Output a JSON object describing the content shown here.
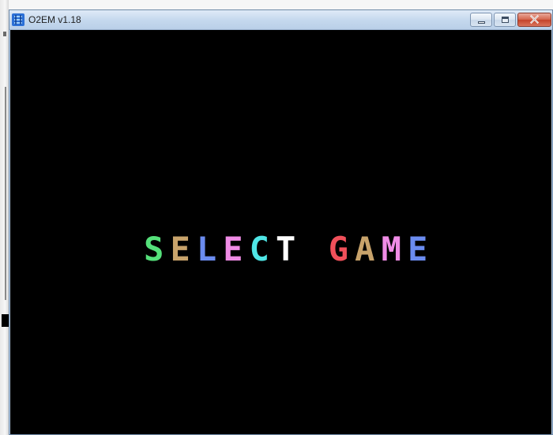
{
  "window": {
    "title": "O2EM v1.18",
    "app_icon": "o2em-app-icon",
    "controls": {
      "minimize": "minimize-icon",
      "maximize": "maximize-icon",
      "close": "close-icon"
    }
  },
  "screen": {
    "background_color": "#000000",
    "text_lines": [
      {
        "words": [
          {
            "letters": [
              {
                "char": "S",
                "color": "#55e07a"
              },
              {
                "char": "E",
                "color": "#c8a36b"
              },
              {
                "char": "L",
                "color": "#6b8cf0"
              },
              {
                "char": "E",
                "color": "#f08ce6"
              },
              {
                "char": "C",
                "color": "#4fe6e6"
              },
              {
                "char": "T",
                "color": "#ffffff"
              }
            ]
          },
          {
            "letters": [
              {
                "char": "G",
                "color": "#f0505a"
              },
              {
                "char": "A",
                "color": "#c8a36b"
              },
              {
                "char": "M",
                "color": "#f08ce6"
              },
              {
                "char": "E",
                "color": "#6b8cf0"
              }
            ]
          }
        ]
      }
    ]
  }
}
